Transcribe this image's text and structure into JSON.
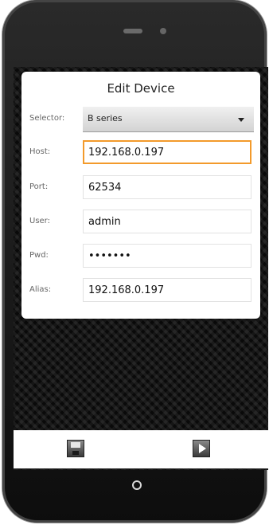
{
  "dialog": {
    "title": "Edit Device"
  },
  "fields": {
    "selector": {
      "label": "Selector:",
      "value": "B series"
    },
    "host": {
      "label": "Host:",
      "value": "192.168.0.197"
    },
    "port": {
      "label": "Port:",
      "value": "62534"
    },
    "user": {
      "label": "User:",
      "value": "admin"
    },
    "pwd": {
      "label": "Pwd:",
      "value": "1234567"
    },
    "alias": {
      "label": "Alias:",
      "value": "192.168.0.197"
    }
  },
  "toolbar": {
    "save_icon": "floppy-disk-icon",
    "play_icon": "play-icon"
  },
  "colors": {
    "focus_border": "#f39a2b",
    "dialog_bg": "#ffffff",
    "screen_bg": "#161616"
  }
}
